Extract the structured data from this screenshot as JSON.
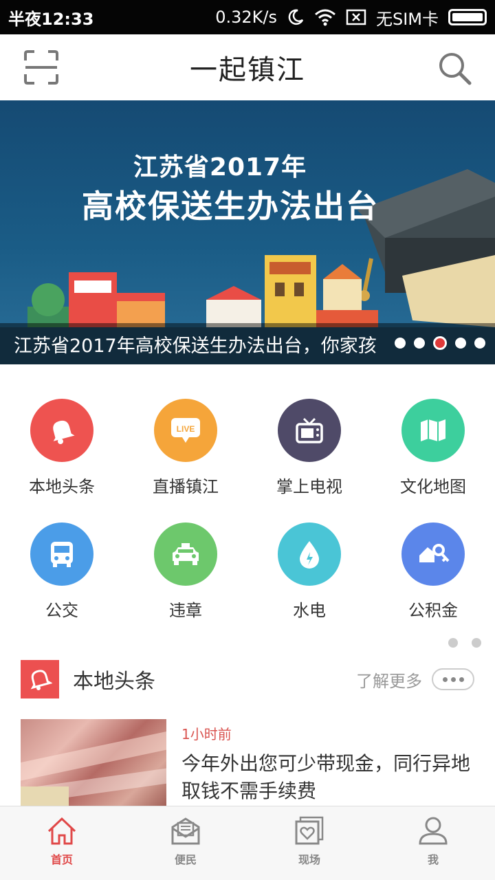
{
  "status_bar": {
    "time": "半夜12:33",
    "speed": "0.32K/s",
    "sim": "无SIM卡"
  },
  "header": {
    "title": "一起镇江"
  },
  "banner": {
    "headline_line1": "江苏省2017年",
    "headline_line2": "高校保送生办法出台",
    "caption": "江苏省2017年高校保送生办法出台，你家孩",
    "slide_count": 5,
    "active_slide": 3
  },
  "grid": [
    {
      "label": "本地头条",
      "icon": "bell-icon",
      "color": "#ee5350"
    },
    {
      "label": "直播镇江",
      "icon": "live-icon",
      "color": "#f5a53a"
    },
    {
      "label": "掌上电视",
      "icon": "tv-icon",
      "color": "#4f4a68"
    },
    {
      "label": "文化地图",
      "icon": "map-icon",
      "color": "#3dcf9d"
    },
    {
      "label": "公交",
      "icon": "bus-icon",
      "color": "#4b9de8"
    },
    {
      "label": "违章",
      "icon": "car-icon",
      "color": "#6dc86c"
    },
    {
      "label": "水电",
      "icon": "water-drop-icon",
      "color": "#4ac5d6"
    },
    {
      "label": "公积金",
      "icon": "keys-icon",
      "color": "#5b86ea"
    }
  ],
  "section": {
    "title": "本地头条",
    "more": "了解更多"
  },
  "news": [
    {
      "time": "1小时前",
      "headline": "今年外出您可少带现金，同行异地取钱不需手续费"
    }
  ],
  "bottom_nav": [
    {
      "label": "首页",
      "icon": "home-icon",
      "active": true
    },
    {
      "label": "便民",
      "icon": "mail-icon",
      "active": false
    },
    {
      "label": "现场",
      "icon": "heart-photo-icon",
      "active": false
    },
    {
      "label": "我",
      "icon": "person-icon",
      "active": false
    }
  ],
  "colors": {
    "accent": "#e04848",
    "status_bar": "#050505",
    "banner_bg": "#1a5c86"
  }
}
